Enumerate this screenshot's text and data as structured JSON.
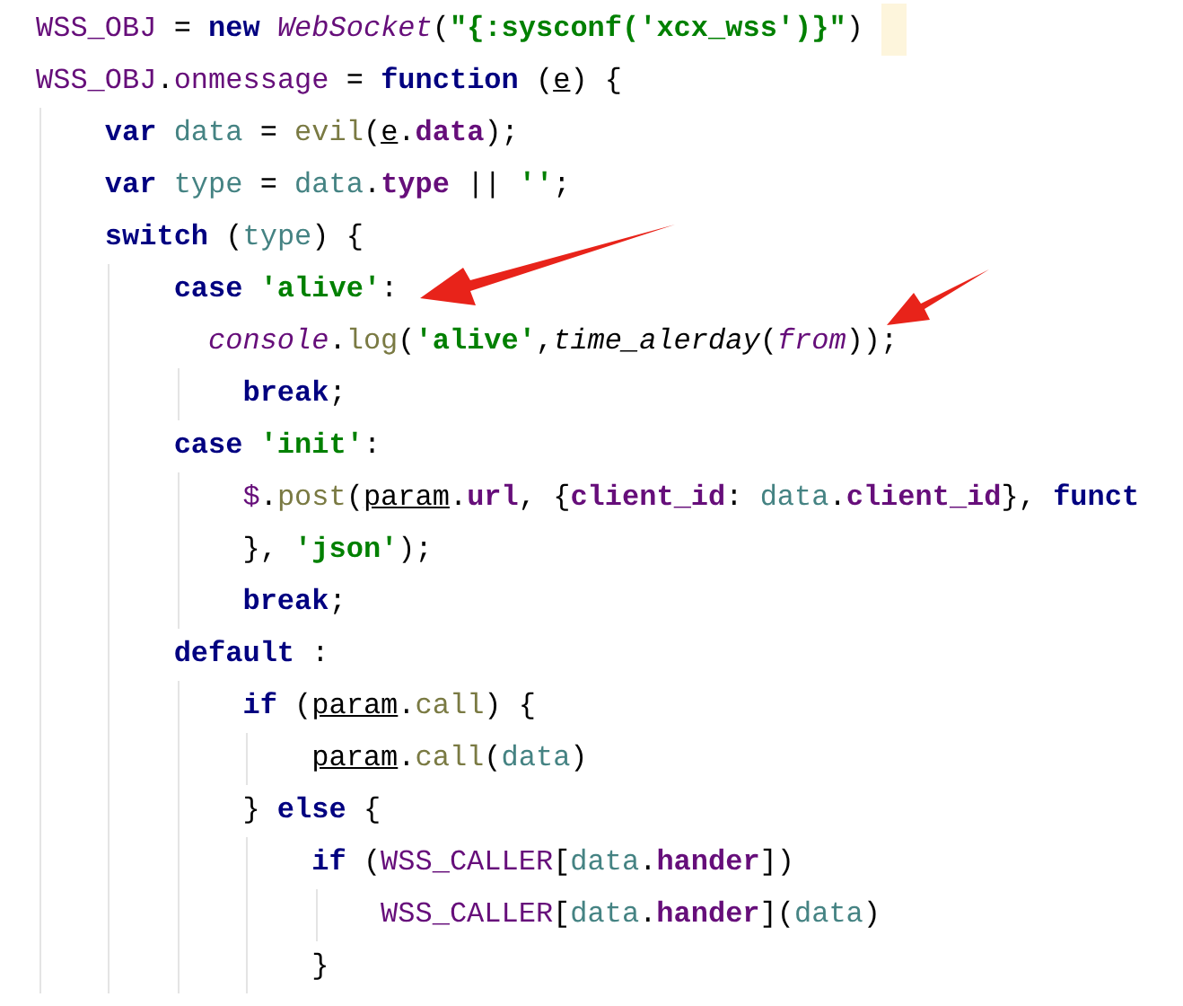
{
  "editor": {
    "lines": [
      {
        "tokens": [
          {
            "kind": "glob",
            "text": "WSS_OBJ"
          },
          {
            "kind": "plain",
            "text": " = "
          },
          {
            "kind": "kw",
            "text": "new"
          },
          {
            "kind": "italic",
            "text": " WebSocket"
          },
          {
            "kind": "plain",
            "text": "("
          },
          {
            "kind": "str",
            "text": "\"{:sysconf('xcx_wss')}\""
          },
          {
            "kind": "plain",
            "text": ")"
          }
        ]
      },
      {
        "tokens": [
          {
            "kind": "glob",
            "text": "WSS_OBJ"
          },
          {
            "kind": "plain",
            "text": "."
          },
          {
            "kind": "glob",
            "text": "onmessage"
          },
          {
            "kind": "plain",
            "text": " = "
          },
          {
            "kind": "kw",
            "text": "function"
          },
          {
            "kind": "plain",
            "text": " ("
          },
          {
            "kind": "param",
            "text": "e"
          },
          {
            "kind": "plain",
            "text": ") {"
          }
        ]
      },
      {
        "tokens": [
          {
            "kind": "kw",
            "text": "    var"
          },
          {
            "kind": "local",
            "text": " data"
          },
          {
            "kind": "plain",
            "text": " = "
          },
          {
            "kind": "method",
            "text": "evil"
          },
          {
            "kind": "plain",
            "text": "("
          },
          {
            "kind": "param",
            "text": "e"
          },
          {
            "kind": "plain",
            "text": "."
          },
          {
            "kind": "field",
            "text": "data"
          },
          {
            "kind": "plain",
            "text": ");"
          }
        ]
      },
      {
        "tokens": [
          {
            "kind": "kw",
            "text": "    var"
          },
          {
            "kind": "local",
            "text": " type"
          },
          {
            "kind": "plain",
            "text": " = "
          },
          {
            "kind": "local",
            "text": "data"
          },
          {
            "kind": "plain",
            "text": "."
          },
          {
            "kind": "field",
            "text": "type"
          },
          {
            "kind": "plain",
            "text": " || "
          },
          {
            "kind": "str",
            "text": "''"
          },
          {
            "kind": "plain",
            "text": ";"
          }
        ]
      },
      {
        "tokens": [
          {
            "kind": "kw",
            "text": "    switch"
          },
          {
            "kind": "plain",
            "text": " ("
          },
          {
            "kind": "local",
            "text": "type"
          },
          {
            "kind": "plain",
            "text": ") {"
          }
        ]
      },
      {
        "tokens": [
          {
            "kind": "kw",
            "text": "        case"
          },
          {
            "kind": "str",
            "text": " 'alive'"
          },
          {
            "kind": "plain",
            "text": ":"
          }
        ]
      },
      {
        "tokens": [
          {
            "kind": "italic",
            "text": "          console"
          },
          {
            "kind": "plain",
            "text": "."
          },
          {
            "kind": "method",
            "text": "log"
          },
          {
            "kind": "plain",
            "text": "("
          },
          {
            "kind": "str",
            "text": "'alive'"
          },
          {
            "kind": "plain",
            "text": ","
          },
          {
            "kind": "fn",
            "text": "time_alerday"
          },
          {
            "kind": "plain",
            "text": "("
          },
          {
            "kind": "italic",
            "text": "from"
          },
          {
            "kind": "plain",
            "text": "));"
          }
        ]
      },
      {
        "tokens": [
          {
            "kind": "kw",
            "text": "            break"
          },
          {
            "kind": "plain",
            "text": ";"
          }
        ]
      },
      {
        "tokens": [
          {
            "kind": "kw",
            "text": "        case"
          },
          {
            "kind": "str",
            "text": " 'init'"
          },
          {
            "kind": "plain",
            "text": ":"
          }
        ]
      },
      {
        "tokens": [
          {
            "kind": "glob",
            "text": "            $"
          },
          {
            "kind": "plain",
            "text": "."
          },
          {
            "kind": "method",
            "text": "post"
          },
          {
            "kind": "plain",
            "text": "("
          },
          {
            "kind": "param",
            "text": "param"
          },
          {
            "kind": "plain",
            "text": "."
          },
          {
            "kind": "field",
            "text": "url"
          },
          {
            "kind": "plain",
            "text": ", {"
          },
          {
            "kind": "field",
            "text": "client_id"
          },
          {
            "kind": "plain",
            "text": ": "
          },
          {
            "kind": "local",
            "text": "data"
          },
          {
            "kind": "plain",
            "text": "."
          },
          {
            "kind": "field",
            "text": "client_id"
          },
          {
            "kind": "plain",
            "text": "}, "
          },
          {
            "kind": "kw",
            "text": "funct"
          }
        ]
      },
      {
        "tokens": [
          {
            "kind": "plain",
            "text": "            }, "
          },
          {
            "kind": "str",
            "text": "'json'"
          },
          {
            "kind": "plain",
            "text": ");"
          }
        ]
      },
      {
        "tokens": [
          {
            "kind": "kw",
            "text": "            break"
          },
          {
            "kind": "plain",
            "text": ";"
          }
        ]
      },
      {
        "tokens": [
          {
            "kind": "kw",
            "text": "        default"
          },
          {
            "kind": "plain",
            "text": " :"
          }
        ]
      },
      {
        "tokens": [
          {
            "kind": "kw",
            "text": "            if"
          },
          {
            "kind": "plain",
            "text": " ("
          },
          {
            "kind": "param",
            "text": "param"
          },
          {
            "kind": "plain",
            "text": "."
          },
          {
            "kind": "method",
            "text": "call"
          },
          {
            "kind": "plain",
            "text": ") {"
          }
        ]
      },
      {
        "tokens": [
          {
            "kind": "param",
            "text": "                param"
          },
          {
            "kind": "plain",
            "text": "."
          },
          {
            "kind": "method",
            "text": "call"
          },
          {
            "kind": "plain",
            "text": "("
          },
          {
            "kind": "local",
            "text": "data"
          },
          {
            "kind": "plain",
            "text": ")"
          }
        ]
      },
      {
        "tokens": [
          {
            "kind": "plain",
            "text": "            } "
          },
          {
            "kind": "kw",
            "text": "else"
          },
          {
            "kind": "plain",
            "text": " {"
          }
        ]
      },
      {
        "tokens": [
          {
            "kind": "kw",
            "text": "                if"
          },
          {
            "kind": "plain",
            "text": " ("
          },
          {
            "kind": "glob",
            "text": "WSS_CALLER"
          },
          {
            "kind": "plain",
            "text": "["
          },
          {
            "kind": "local",
            "text": "data"
          },
          {
            "kind": "plain",
            "text": "."
          },
          {
            "kind": "field",
            "text": "hander"
          },
          {
            "kind": "plain",
            "text": "])"
          }
        ]
      },
      {
        "tokens": [
          {
            "kind": "glob",
            "text": "                    WSS_CALLER"
          },
          {
            "kind": "plain",
            "text": "["
          },
          {
            "kind": "local",
            "text": "data"
          },
          {
            "kind": "plain",
            "text": "."
          },
          {
            "kind": "field",
            "text": "hander"
          },
          {
            "kind": "plain",
            "text": "]("
          },
          {
            "kind": "local",
            "text": "data"
          },
          {
            "kind": "plain",
            "text": ")"
          }
        ]
      },
      {
        "tokens": [
          {
            "kind": "plain",
            "text": "                }"
          }
        ]
      }
    ]
  }
}
